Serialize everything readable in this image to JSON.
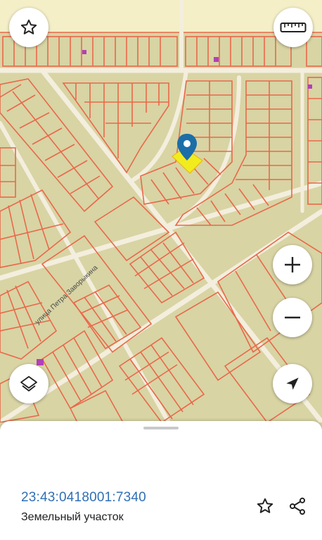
{
  "map": {
    "street_label": "улица Петра Заворыкина",
    "colors": {
      "background": "#d8d4a4",
      "road": "#f3eedd",
      "parcel_line": "#e9684a",
      "highlight": "#f2ec1e",
      "pin": "#1c6ea8",
      "poi": "#b240b8",
      "top_strip": "#f5efc8"
    }
  },
  "controls": {
    "favorite": "star-icon",
    "ruler": "ruler-icon",
    "zoom_in": "plus-icon",
    "zoom_out": "minus-icon",
    "layers": "layers-icon",
    "locate": "navigation-arrow-icon"
  },
  "sheet": {
    "cadastral_number": "23:43:0418001:7340",
    "object_type": "Земельный участок",
    "actions": [
      "star-outline-icon",
      "share-icon"
    ]
  }
}
